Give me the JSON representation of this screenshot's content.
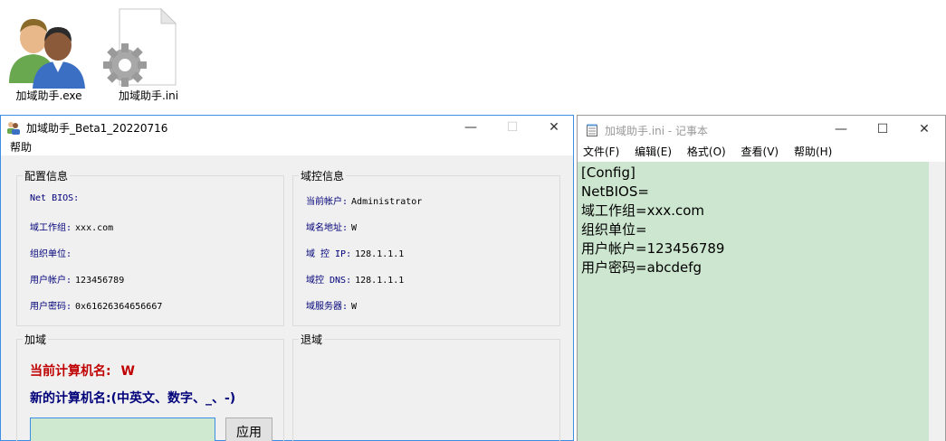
{
  "desktop": {
    "icons": [
      {
        "label": "加域助手.exe"
      },
      {
        "label": "加域助手.ini"
      }
    ]
  },
  "app_window": {
    "title": "加域助手_Beta1_20220716",
    "menu": {
      "help": "帮助"
    },
    "config": {
      "title": "配置信息",
      "rows": [
        {
          "key": "Net BIOS:",
          "value": ""
        },
        {
          "key": "域工作组:",
          "value": "xxx.com"
        },
        {
          "key": "组织单位:",
          "value": ""
        },
        {
          "key": "用户帐户:",
          "value": "123456789"
        },
        {
          "key": "用户密码:",
          "value": "0x61626364656667"
        }
      ]
    },
    "domain_ctrl": {
      "title": "域控信息",
      "rows": [
        {
          "key": "当前帐户:",
          "value": "Administrator"
        },
        {
          "key": "域名地址:",
          "value": "W"
        },
        {
          "key": "域 控 IP:",
          "value": "128.1.1.1"
        },
        {
          "key": "域控 DNS:",
          "value": "128.1.1.1"
        },
        {
          "key": "域服务器:",
          "value": "W"
        }
      ]
    },
    "join": {
      "title": "加域",
      "current_label": "当前计算机名:",
      "current_value": "W",
      "new_label": "新的计算机名:(中英文、数字、_、-)",
      "input_value": "",
      "apply_label": "应用"
    },
    "leave": {
      "title": "退域"
    }
  },
  "notepad": {
    "title": "加域助手.ini - 记事本",
    "menu": [
      "文件(F)",
      "编辑(E)",
      "格式(O)",
      "查看(V)",
      "帮助(H)"
    ],
    "content": "[Config]\nNetBIOS=\n域工作组=xxx.com\n组织单位=\n用户帐户=123456789\n用户密码=abcdefg"
  }
}
